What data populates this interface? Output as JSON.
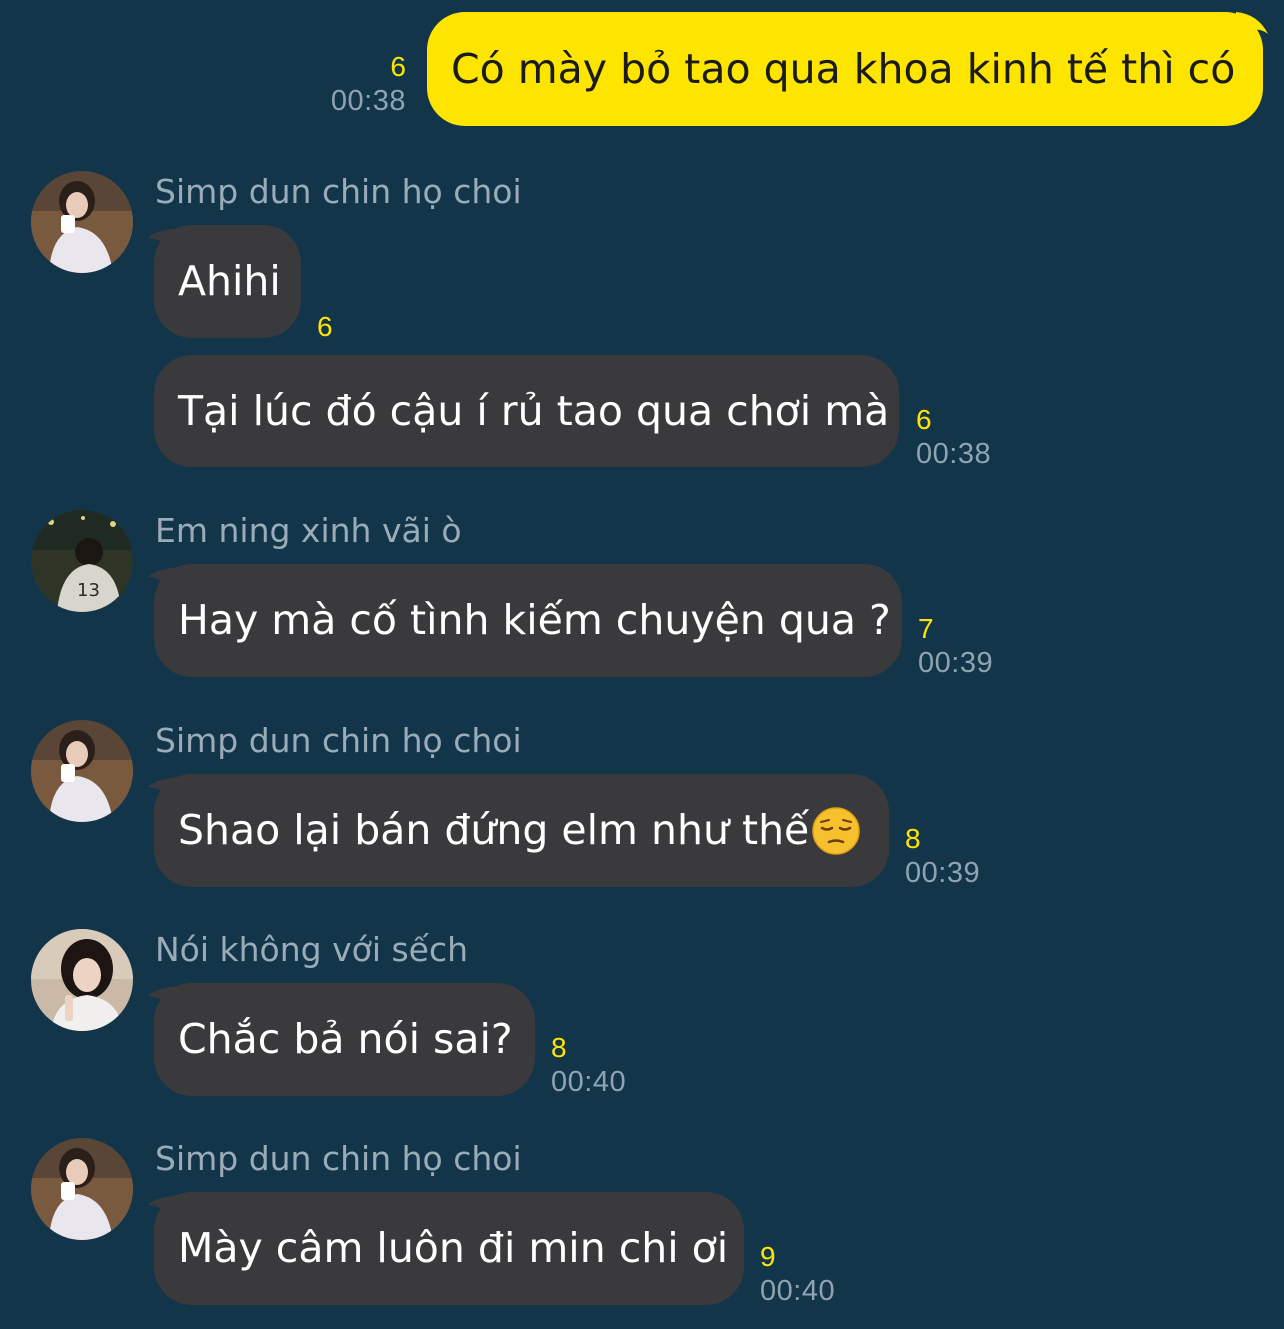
{
  "messages": {
    "out1": {
      "text": "Có mày bỏ tao qua khoa kinh tế thì có",
      "count": "6",
      "time": "00:38"
    },
    "g1": {
      "sender": "Simp dun chin họ choi",
      "m1": {
        "text": "Ahihi",
        "count": "6"
      },
      "m2": {
        "text": "Tại lúc đó cậu í rủ tao qua chơi mà",
        "count": "6",
        "time": "00:38"
      }
    },
    "g2": {
      "sender": "Em ning xinh vãi ò",
      "m1": {
        "text": "Hay mà cố tình kiếm chuyện qua ?",
        "count": "7",
        "time": "00:39"
      }
    },
    "g3": {
      "sender": "Simp dun chin họ choi",
      "m1": {
        "text": "Shao lại bán đứng elm như thế",
        "emoji": "pensive-face-icon",
        "count": "8",
        "time": "00:39"
      }
    },
    "g4": {
      "sender": "Nói không với sếch",
      "m1": {
        "text": "Chắc bả nói sai?",
        "count": "8",
        "time": "00:40"
      }
    },
    "g5": {
      "sender": "Simp dun chin họ choi",
      "m1": {
        "text": "Mày câm luôn đi min chi ơi",
        "count": "9",
        "time": "00:40"
      }
    }
  },
  "colors": {
    "background": "#12354a",
    "outgoing_bubble": "#fee500",
    "incoming_bubble": "#3a3a3c",
    "unread_count": "#fee500",
    "timestamp": "#8fa3b0",
    "sender_name": "#9aacb7"
  }
}
